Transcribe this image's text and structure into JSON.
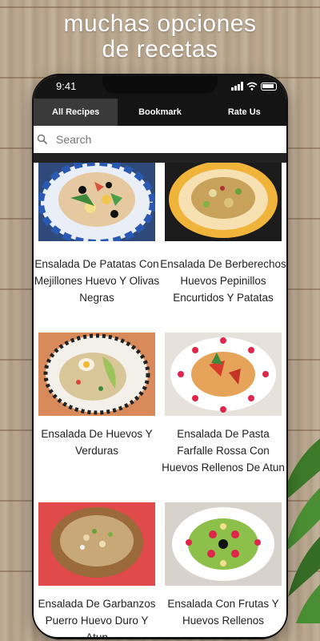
{
  "promo": {
    "line1": "muchas opciones",
    "line2": "de recetas"
  },
  "status_bar": {
    "time": "9:41"
  },
  "tabs": [
    {
      "label": "All Recipes",
      "active": true
    },
    {
      "label": "Bookmark",
      "active": false
    },
    {
      "label": "Rate Us",
      "active": false
    }
  ],
  "search": {
    "placeholder": "Search"
  },
  "recipes": [
    {
      "title": "Ensalada De Patatas Con Mejillones Huevo Y Olivas Negras"
    },
    {
      "title": "Ensalada De Berberechos Huevos Pepinillos Encurtidos Y Patatas"
    },
    {
      "title": "Ensalada De Huevos Y Verduras"
    },
    {
      "title": "Ensalada De Pasta Farfalle Rossa Con Huevos Rellenos De Atun"
    },
    {
      "title": "Ensalada De Garbanzos Puerro Huevo Duro Y Atun"
    },
    {
      "title": "Ensalada Con Frutas Y Huevos Rellenos"
    }
  ],
  "colors": {
    "tab_bar": "#141414",
    "active_tab": "#3a3a3a",
    "accent_dark": "#222222"
  }
}
